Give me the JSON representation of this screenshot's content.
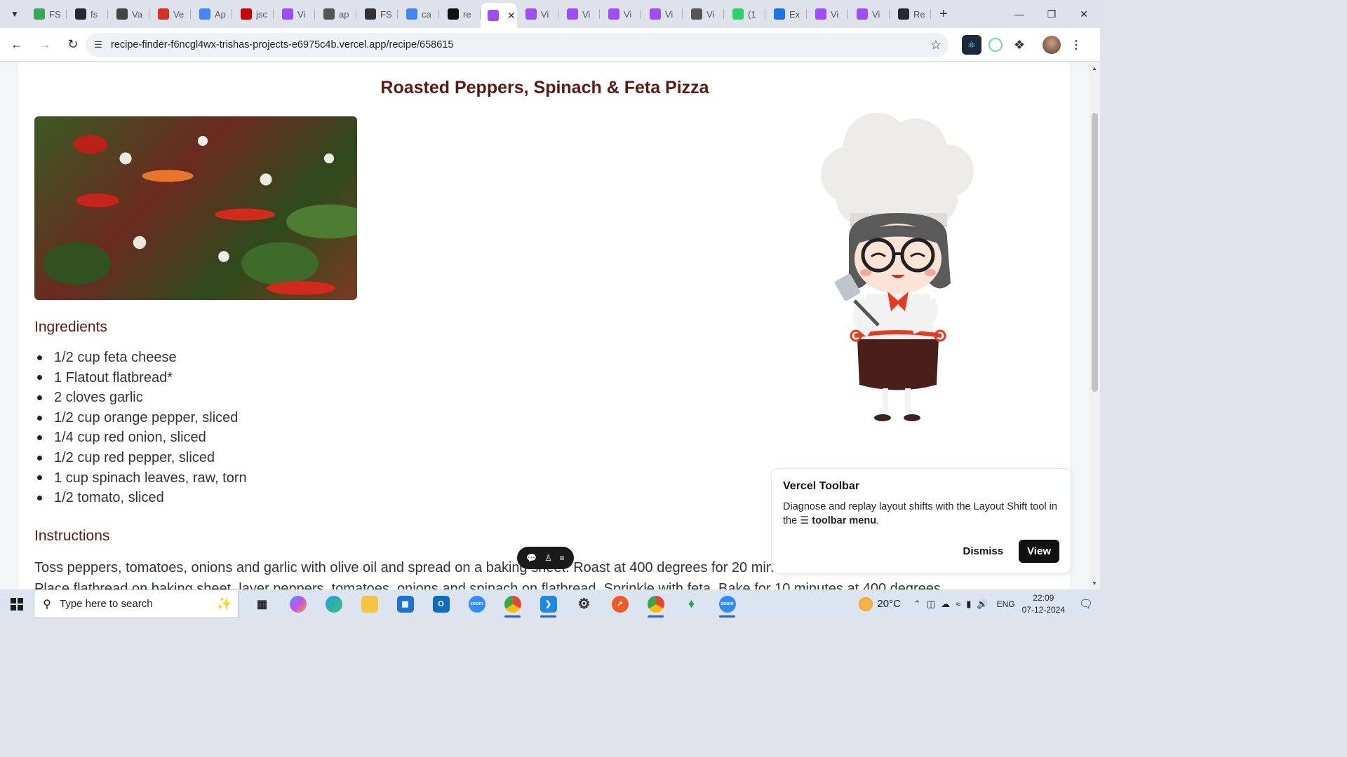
{
  "browser": {
    "tabs": [
      {
        "label": "FS",
        "icon": "chrome-google-icon",
        "color": "#34a853"
      },
      {
        "label": "fs",
        "icon": "github-icon",
        "color": "#24292f"
      },
      {
        "label": "Va",
        "icon": "openai-icon",
        "color": "#444444"
      },
      {
        "label": "Ve",
        "icon": "gmail-icon",
        "color": "#d93025"
      },
      {
        "label": "Ap",
        "icon": "google-icon",
        "color": "#4285f4"
      },
      {
        "label": "jsc",
        "icon": "jsconsole-icon",
        "color": "#cc0000"
      },
      {
        "label": "Vi",
        "icon": "vite-icon",
        "color": "#9d4dfb"
      },
      {
        "label": "ap",
        "icon": "globe-icon",
        "color": "#555555"
      },
      {
        "label": "FS",
        "icon": "contact-icon",
        "color": "#333333"
      },
      {
        "label": "ca",
        "icon": "google-icon",
        "color": "#4285f4"
      },
      {
        "label": "re",
        "icon": "render-icon",
        "color": "#111111"
      },
      {
        "label": "",
        "icon": "vite-icon",
        "color": "#9d4dfb",
        "active": true
      },
      {
        "label": "Vi",
        "icon": "vite-icon",
        "color": "#9d4dfb"
      },
      {
        "label": "Vi",
        "icon": "vite-icon",
        "color": "#9d4dfb"
      },
      {
        "label": "Vi",
        "icon": "vite-icon",
        "color": "#9d4dfb"
      },
      {
        "label": "Vi",
        "icon": "vite-icon",
        "color": "#9d4dfb"
      },
      {
        "label": "Vi",
        "icon": "globe-icon",
        "color": "#555555"
      },
      {
        "label": "(1",
        "icon": "whatsapp-icon",
        "color": "#25d366"
      },
      {
        "label": "Ex",
        "icon": "puzzle-icon",
        "color": "#1a73e8"
      },
      {
        "label": "Vi",
        "icon": "vite-icon",
        "color": "#9d4dfb"
      },
      {
        "label": "Vi",
        "icon": "vite-icon",
        "color": "#9d4dfb"
      },
      {
        "label": "Re",
        "icon": "github-icon",
        "color": "#24292f"
      }
    ],
    "url": "recipe-finder-f6ncgl4wx-trishas-projects-e6975c4b.vercel.app/recipe/658615"
  },
  "page": {
    "title": "Roasted Peppers, Spinach & Feta Pizza",
    "ingredients_heading": "Ingredients",
    "ingredients": [
      "1/2 cup feta cheese",
      "1 Flatout flatbread*",
      "2 cloves garlic",
      "1/2 cup orange pepper, sliced",
      "1/4 cup red onion, sliced",
      "1/2 cup red pepper, sliced",
      "1 cup spinach leaves, raw, torn",
      "1/2 tomato, sliced"
    ],
    "instructions_heading": "Instructions",
    "instructions_line1": "Toss peppers, tomatoes, onions and garlic with olive oil and spread on a baking sheet. Roast at 400 degrees for 20 minutes.",
    "instructions_line2": "Place flatbread on baking sheet, layer peppers, tomatoes, onions and spinach on flatbread. Sprinkle with feta. Bake for 10 minutes at 400 degrees."
  },
  "vercel_toolbar": {
    "title": "Vercel Toolbar",
    "body_prefix": "Diagnose and replay layout shifts with the Layout Shift tool in the",
    "body_bold": "toolbar menu",
    "body_suffix": ".",
    "dismiss": "Dismiss",
    "view": "View"
  },
  "taskbar": {
    "search_placeholder": "Type here to search",
    "weather": "20°C",
    "language": "ENG",
    "time": "22:09",
    "date": "07-12-2024"
  }
}
